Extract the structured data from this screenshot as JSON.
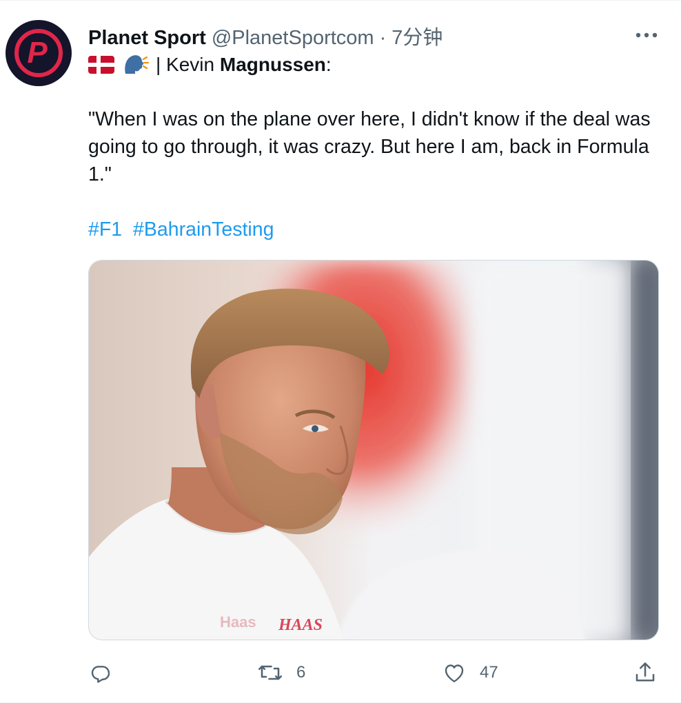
{
  "author": {
    "name": "Planet Sport",
    "handle": "@PlanetSportcom",
    "separator": "·",
    "time": "7分钟"
  },
  "tweet": {
    "line1_prefix": "| Kevin ",
    "line1_bold": "Magnussen",
    "line1_suffix": ":",
    "quote": "\"When I was on the plane over here, I didn't know if the deal was going to go through, it was crazy. But here I am, back in Formula 1.\"",
    "hashtags": [
      "#F1",
      "#BahrainTesting"
    ]
  },
  "photo": {
    "shirt_logo_text": "Haas",
    "shirt_logo_text2": "HAAS"
  },
  "actions": {
    "reply_count": "",
    "retweet_count": "6",
    "like_count": "47"
  },
  "icons": {
    "avatar": "planet-sport-logo",
    "flag": "denmark-flag-icon",
    "speaking": "speaking-head-icon",
    "more": "more-icon",
    "reply": "reply-icon",
    "retweet": "retweet-icon",
    "like": "like-icon",
    "share": "share-icon"
  },
  "colors": {
    "link": "#1d9bf0",
    "secondary": "#536471",
    "brand_red": "#e0264a",
    "brand_dark": "#14142b"
  }
}
